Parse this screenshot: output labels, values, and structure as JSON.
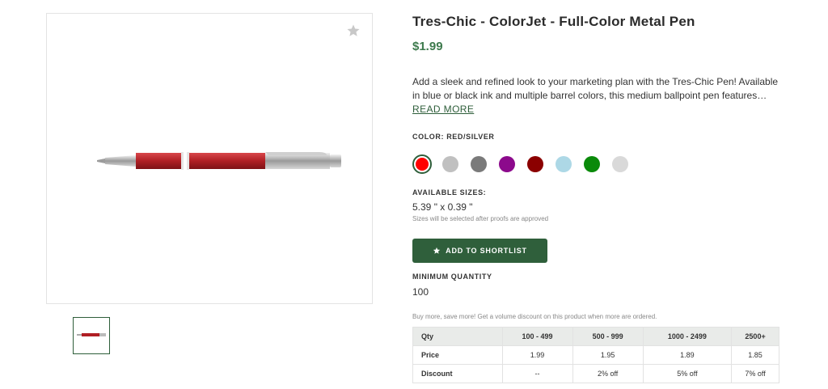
{
  "product": {
    "title": "Tres-Chic - ColorJet - Full-Color Metal Pen",
    "price": "$1.99",
    "description": "Add a sleek and refined look to your marketing plan with the Tres-Chic Pen! Available in blue or black ink and multiple barrel colors, this medium ballpoint pen features…",
    "read_more": "READ MORE"
  },
  "color": {
    "label": "COLOR: RED/SILVER",
    "swatches": [
      {
        "name": "red",
        "hex": "#ff0000",
        "selected": true
      },
      {
        "name": "light-gray",
        "hex": "#c0c0c0"
      },
      {
        "name": "dark-gray",
        "hex": "#7a7a7a"
      },
      {
        "name": "purple",
        "hex": "#8c0a8c"
      },
      {
        "name": "maroon",
        "hex": "#8b0000"
      },
      {
        "name": "light-blue",
        "hex": "#add8e6"
      },
      {
        "name": "green",
        "hex": "#0a8a0a"
      },
      {
        "name": "silver",
        "hex": "#d9d9d9"
      }
    ]
  },
  "sizes": {
    "label": "AVAILABLE SIZES:",
    "value": "5.39 \" x 0.39 \"",
    "note": "Sizes will be selected after proofs are approved"
  },
  "shortlist_button": "ADD TO SHORTLIST",
  "minimum": {
    "label": "MINIMUM QUANTITY",
    "value": "100"
  },
  "bulk_note": "Buy more, save more! Get a volume discount on this product when more are ordered.",
  "pricing_table": {
    "headers": [
      "Qty",
      "100 - 499",
      "500 - 999",
      "1000 - 2499",
      "2500+"
    ],
    "rows": [
      {
        "label": "Price",
        "values": [
          "1.99",
          "1.95",
          "1.89",
          "1.85"
        ]
      },
      {
        "label": "Discount",
        "values": [
          "--",
          "2% off",
          "5% off",
          "7% off"
        ]
      }
    ]
  },
  "colors": {
    "accent": "#2f5f3b",
    "price": "#3d7a4d",
    "pen_barrel": "#b01f24"
  },
  "icons": {
    "favorite": "star-icon",
    "button": "star-icon"
  }
}
